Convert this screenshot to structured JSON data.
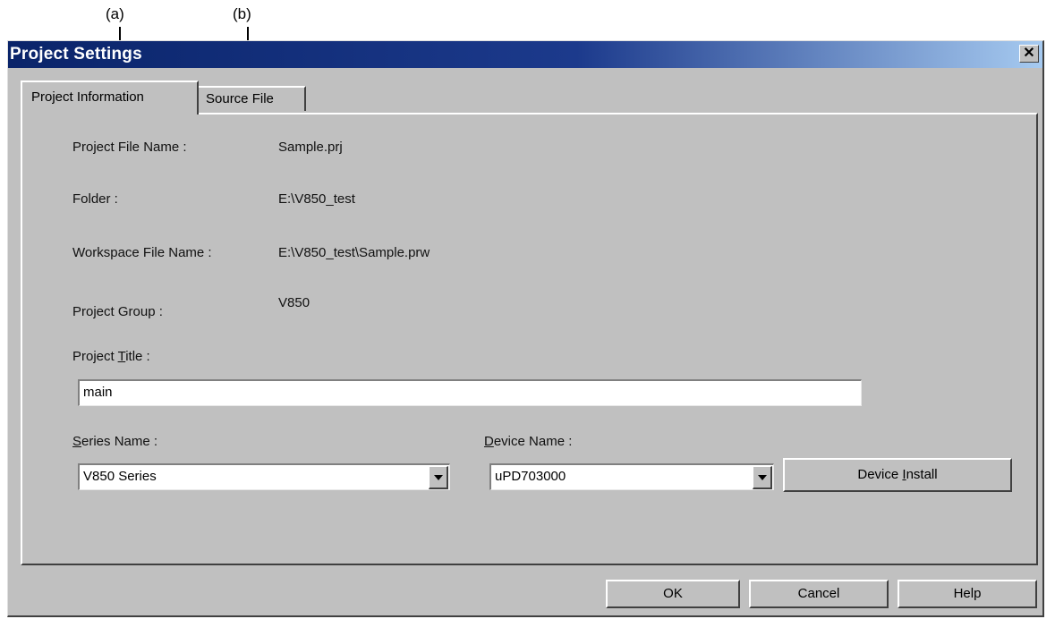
{
  "callouts": {
    "a": "(a)",
    "b": "(b)"
  },
  "window": {
    "title": "Project Settings",
    "close_glyph": "✕"
  },
  "tabs": [
    {
      "label": "Project Information",
      "active": true
    },
    {
      "label": "Source File",
      "active": false
    }
  ],
  "info": {
    "project_file_label": "Project File Name :",
    "project_file_value": "Sample.prj",
    "folder_label": "Folder :",
    "folder_value": "E:\\V850_test",
    "workspace_label": "Workspace File Name :",
    "workspace_value": "E:\\V850_test\\Sample.prw",
    "group_label": "Project Group :",
    "group_value": "V850"
  },
  "title_section": {
    "label_prefix": "Project ",
    "label_accel": "T",
    "label_rest": "itle :",
    "value": "main"
  },
  "series": {
    "label_accel": "S",
    "label_rest": "eries Name :",
    "value": "V850 Series"
  },
  "device": {
    "label_accel": "D",
    "label_rest": "evice Name :",
    "value": "uPD703000",
    "install_prefix": "Device ",
    "install_accel": "I",
    "install_rest": "nstall"
  },
  "buttons": {
    "ok": "OK",
    "cancel": "Cancel",
    "help": "Help"
  },
  "colors": {
    "title_bar": "#0a246a",
    "face": "#c0c0c0"
  }
}
